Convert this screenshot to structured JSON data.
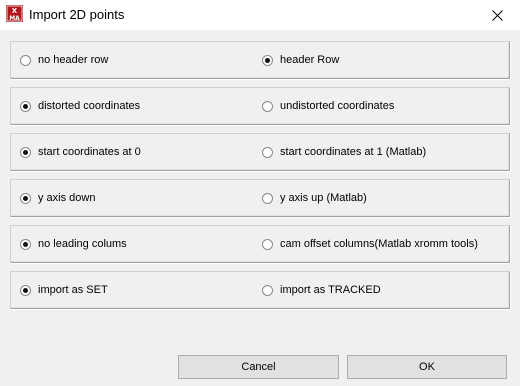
{
  "window": {
    "title": "Import 2D points",
    "icon": "xmalab-app-icon",
    "icon_text": "X\nMA",
    "close_glyph": "✕"
  },
  "option_rows": [
    {
      "left": {
        "label": "no header row",
        "checked": false
      },
      "right": {
        "label": "header Row",
        "checked": true
      }
    },
    {
      "left": {
        "label": "distorted coordinates",
        "checked": true
      },
      "right": {
        "label": "undistorted coordinates",
        "checked": false
      }
    },
    {
      "left": {
        "label": "start coordinates at 0",
        "checked": true
      },
      "right": {
        "label": "start coordinates at 1 (Matlab)",
        "checked": false
      }
    },
    {
      "left": {
        "label": "y axis down",
        "checked": true
      },
      "right": {
        "label": "y axis up (Matlab)",
        "checked": false
      }
    },
    {
      "left": {
        "label": "no leading colums",
        "checked": true
      },
      "right": {
        "label": "cam offset columns(Matlab xromm tools)",
        "checked": false
      }
    },
    {
      "left": {
        "label": "import as SET",
        "checked": true
      },
      "right": {
        "label": "import as TRACKED",
        "checked": false
      }
    }
  ],
  "buttons": {
    "cancel_label": "Cancel",
    "ok_label": "OK"
  },
  "colors": {
    "dialog_bg": "#f0f0f0",
    "titlebar_bg": "#ffffff",
    "icon_red": "#b0161a",
    "button_bg": "#e1e1e1"
  }
}
